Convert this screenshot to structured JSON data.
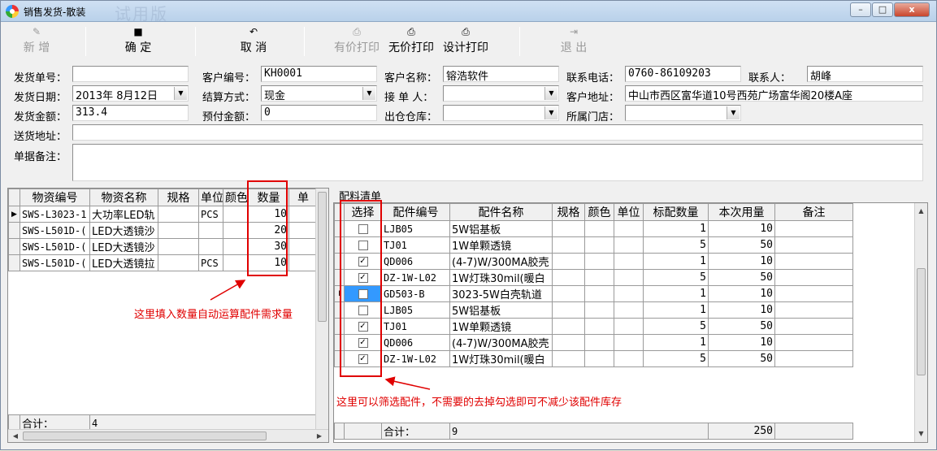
{
  "window": {
    "title": "销售发货-散装",
    "watermark": "试用版",
    "minimize": "–",
    "maximize": "□",
    "close": "x"
  },
  "toolbar": {
    "new": "新 增",
    "confirm": "确 定",
    "cancel": "取 消",
    "print_price": "有价打印",
    "print_noprice": "无价打印",
    "design_print": "设计打印",
    "exit": "退 出"
  },
  "form": {
    "order_no": {
      "label": "发货单号：",
      "value": ""
    },
    "customer_code": {
      "label": "客户编号：",
      "value": "KH0001"
    },
    "customer_name": {
      "label": "客户名称：",
      "value": "镕浩软件"
    },
    "phone": {
      "label": "联系电话：",
      "value": "0760-86109203"
    },
    "contact": {
      "label": "联系人：",
      "value": "胡峰"
    },
    "ship_date": {
      "label": "发货日期：",
      "value": "2013年 8月12日"
    },
    "settle": {
      "label": "结算方式：",
      "value": "现金"
    },
    "handler": {
      "label": "接 单 人：",
      "value": ""
    },
    "address": {
      "label": "客户地址：",
      "value": "中山市西区富华道10号西苑广场富华阁20楼A座"
    },
    "amount": {
      "label": "发货金额：",
      "value": "313.4"
    },
    "prepay": {
      "label": "预付金额：",
      "value": "0"
    },
    "warehouse": {
      "label": "出仓仓库：",
      "value": ""
    },
    "store": {
      "label": "所属门店：",
      "value": ""
    },
    "delivery_addr": {
      "label": "送货地址：",
      "value": ""
    },
    "remark": {
      "label": "单据备注：",
      "value": ""
    }
  },
  "left_grid": {
    "columns": [
      "物资编号",
      "物资名称",
      "规格",
      "单位",
      "颜色",
      "数量",
      "单"
    ],
    "rows": [
      [
        "SWS-L3023-1",
        "大功率LED轨",
        "",
        "PCS",
        "",
        "10"
      ],
      [
        "SWS-L501D-(",
        "LED大透镜沙",
        "",
        "",
        "",
        "20"
      ],
      [
        "SWS-L501D-(",
        "LED大透镜沙",
        "",
        "",
        "",
        "30"
      ],
      [
        "SWS-L501D-(",
        "LED大透镜拉",
        "",
        "PCS",
        "",
        "10"
      ]
    ],
    "total_label": "合计：",
    "total_value": "4"
  },
  "right_grid": {
    "group_label": "配料清单",
    "columns": [
      "选择",
      "配件编号",
      "配件名称",
      "规格",
      "颜色",
      "单位",
      "标配数量",
      "本次用量",
      "备注"
    ],
    "rows": [
      {
        "checked": false,
        "code": "LJB05",
        "name": "5W铝基板",
        "std": "1",
        "use": "10"
      },
      {
        "checked": false,
        "code": "TJ01",
        "name": "1W单颗透镜",
        "std": "5",
        "use": "50"
      },
      {
        "checked": true,
        "code": "QD006",
        "name": "(4-7)W/300MA胶壳",
        "std": "1",
        "use": "10"
      },
      {
        "checked": true,
        "code": "DZ-1W-L02",
        "name": "1W灯珠30mil(暖白",
        "std": "5",
        "use": "50"
      },
      {
        "checked": false,
        "code": "GD503-B",
        "name": "3023-5W白壳轨道",
        "std": "1",
        "use": "10"
      },
      {
        "checked": false,
        "code": "LJB05",
        "name": "5W铝基板",
        "std": "1",
        "use": "10"
      },
      {
        "checked": true,
        "code": "TJ01",
        "name": "1W单颗透镜",
        "std": "5",
        "use": "50"
      },
      {
        "checked": true,
        "code": "QD006",
        "name": "(4-7)W/300MA胶壳",
        "std": "1",
        "use": "10"
      },
      {
        "checked": true,
        "code": "DZ-1W-L02",
        "name": "1W灯珠30mil(暖白",
        "std": "5",
        "use": "50"
      }
    ],
    "total_label": "合计：",
    "total_count": "9",
    "total_use": "250"
  },
  "annotations": {
    "left": "这里填入数量自动运算配件需求量",
    "right": "这里可以筛选配件，不需要的去掉勾选即可不减少该配件库存"
  },
  "colors": {
    "accent_red": "#e00000",
    "select_blue": "#3399ff"
  }
}
